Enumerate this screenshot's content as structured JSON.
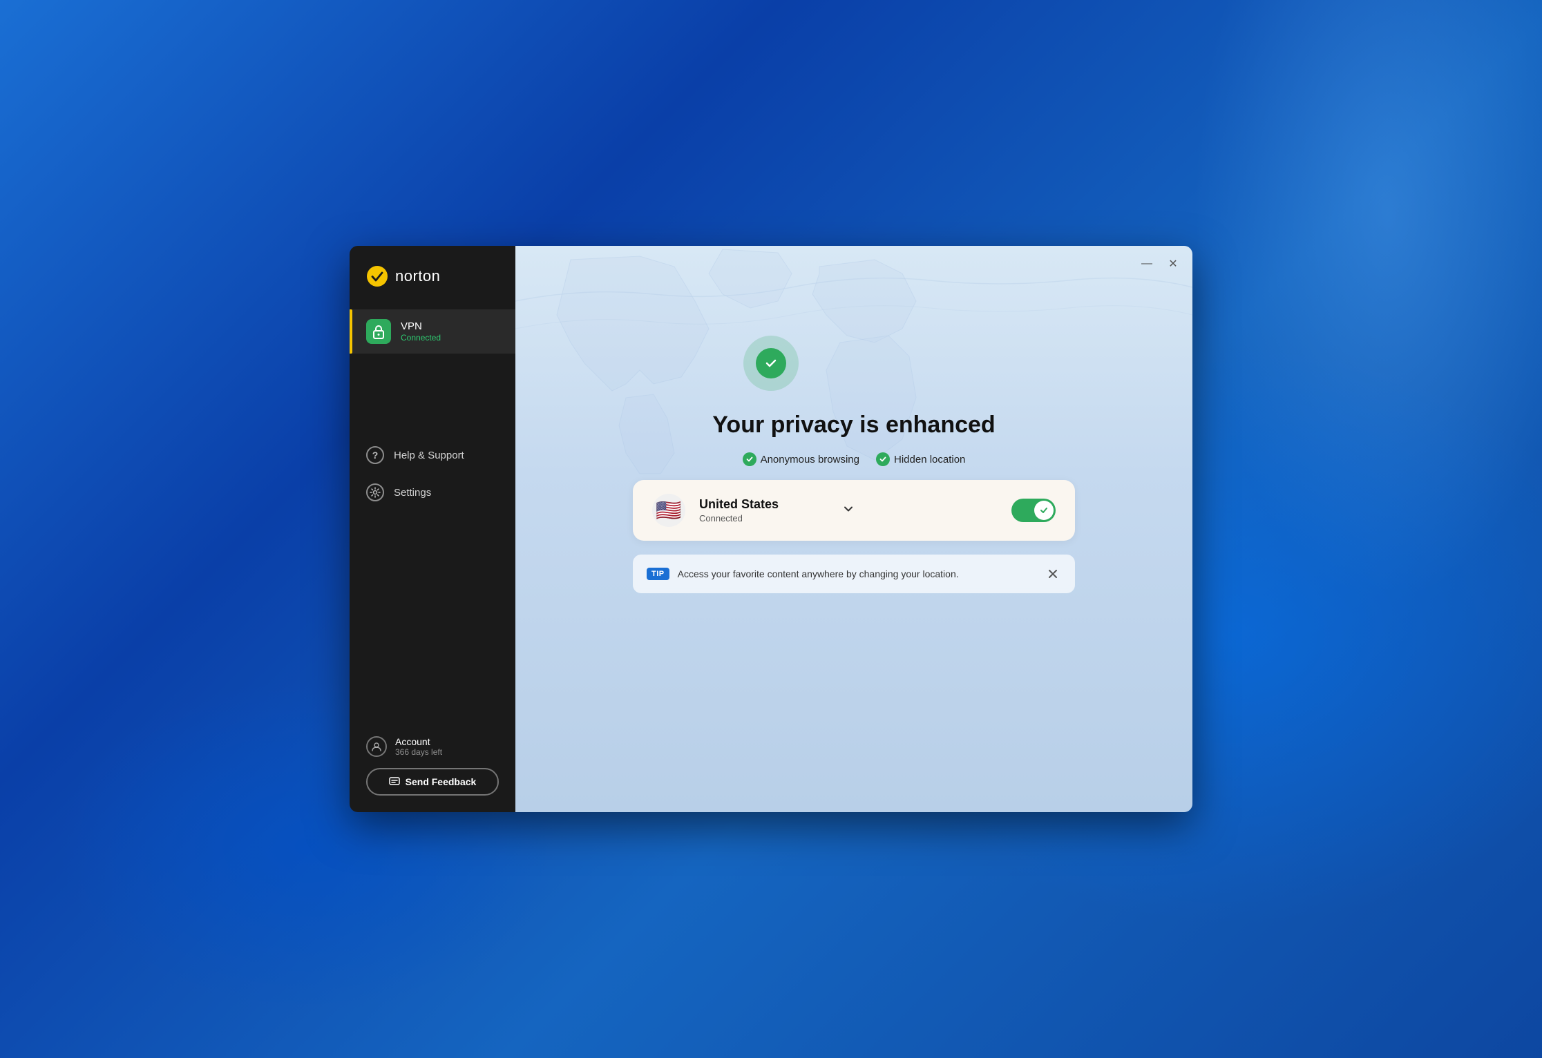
{
  "app": {
    "name": "norton",
    "logo_text": "norton"
  },
  "sidebar": {
    "nav_items": [
      {
        "id": "vpn",
        "label": "VPN",
        "sublabel": "Connected",
        "active": true,
        "type": "vpn"
      }
    ],
    "other_items": [
      {
        "id": "help",
        "label": "Help & Support",
        "type": "circle-icon"
      },
      {
        "id": "settings",
        "label": "Settings",
        "type": "gear-icon"
      }
    ],
    "account": {
      "label": "Account",
      "sublabel": "366 days left"
    },
    "feedback_btn": "Send Feedback"
  },
  "main": {
    "title": "Your privacy is enhanced",
    "badges": [
      {
        "id": "anonymous",
        "text": "Anonymous browsing"
      },
      {
        "id": "hidden",
        "text": "Hidden location"
      }
    ],
    "vpn_card": {
      "country": "United States",
      "status": "Connected",
      "flag_emoji": "🇺🇸"
    },
    "tip": {
      "badge": "TIP",
      "text": "Access your favorite content anywhere by changing your location."
    },
    "window_controls": {
      "minimize": "—",
      "close": "✕"
    }
  },
  "colors": {
    "green": "#2eaa5c",
    "sidebar_bg": "#1a1a1a",
    "accent_yellow": "#f5c400",
    "blue_badge": "#1a6fd4"
  }
}
